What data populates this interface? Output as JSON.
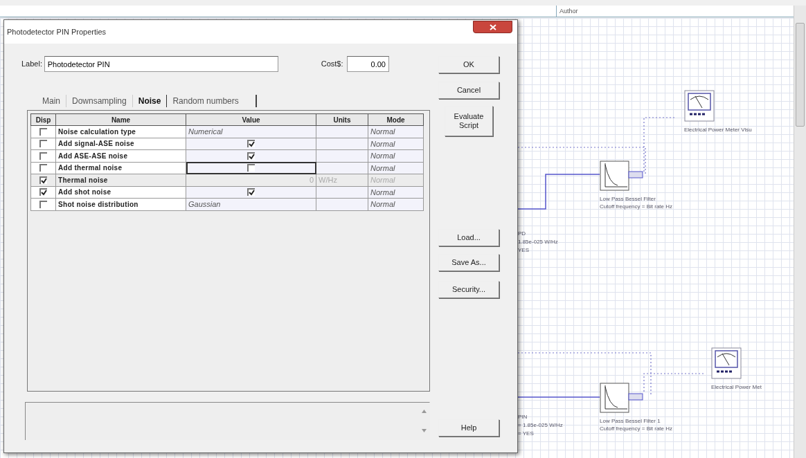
{
  "window": {
    "title": "Photodetector PIN Properties"
  },
  "label_field": {
    "label": "Label:",
    "value": "Photodetector PIN"
  },
  "cost_field": {
    "label": "Cost$:",
    "value": "0.00"
  },
  "tabs": [
    {
      "label": "Main",
      "selected": false
    },
    {
      "label": "Downsampling",
      "selected": false
    },
    {
      "label": "Noise",
      "selected": true
    },
    {
      "label": "Random numbers",
      "selected": false
    }
  ],
  "table": {
    "columns": [
      "Disp",
      "Name",
      "Value",
      "Units",
      "Mode"
    ],
    "rows": [
      {
        "disp": false,
        "name": "Noise calculation type",
        "kind": "text",
        "value": "Numerical",
        "mode": "Normal",
        "disabled": false,
        "focused": false
      },
      {
        "disp": false,
        "name": "Add signal-ASE noise",
        "kind": "check",
        "checked": true,
        "mode": "Normal",
        "disabled": false,
        "focused": false
      },
      {
        "disp": false,
        "name": "Add ASE-ASE noise",
        "kind": "check",
        "checked": true,
        "mode": "Normal",
        "disabled": false,
        "focused": false
      },
      {
        "disp": false,
        "name": "Add thermal noise",
        "kind": "check",
        "checked": false,
        "mode": "Normal",
        "disabled": false,
        "focused": true
      },
      {
        "disp": true,
        "name": "Thermal noise",
        "kind": "number",
        "value": "0",
        "units": "W/Hz",
        "mode": "Normal",
        "disabled": true,
        "focused": false
      },
      {
        "disp": true,
        "name": "Add shot noise",
        "kind": "check",
        "checked": true,
        "mode": "Normal",
        "disabled": false,
        "focused": false
      },
      {
        "disp": false,
        "name": "Shot noise distribution",
        "kind": "text",
        "value": "Gaussian",
        "mode": "Normal",
        "disabled": false,
        "focused": false
      }
    ]
  },
  "buttons_top": [
    "OK",
    "Cancel",
    "Evaluate Script"
  ],
  "buttons_file": [
    "Load...",
    "Save As...",
    "Security..."
  ],
  "help_button": "Help",
  "schematic": {
    "header": "Author",
    "components": [
      {
        "kind": "meter",
        "lines": [
          "Electrical Power Meter Visu"
        ]
      },
      {
        "kind": "filter",
        "lines": [
          "Low Pass Bessel Filter",
          "Cutoff frequency = Bit rate  Hz"
        ]
      },
      {
        "kind": "partial",
        "lines": [
          "PD",
          "1.85e-025  W/Hz",
          "YES"
        ]
      },
      {
        "kind": "meter",
        "lines": [
          "Electrical Power Met"
        ]
      },
      {
        "kind": "partial",
        "lines": [
          "PIN",
          "= 1.85e-025  W/Hz",
          "= YES"
        ]
      },
      {
        "kind": "filter",
        "lines": [
          "Low Pass Bessel Filter  1",
          "Cutoff frequency = Bit rate  Hz"
        ]
      }
    ]
  }
}
